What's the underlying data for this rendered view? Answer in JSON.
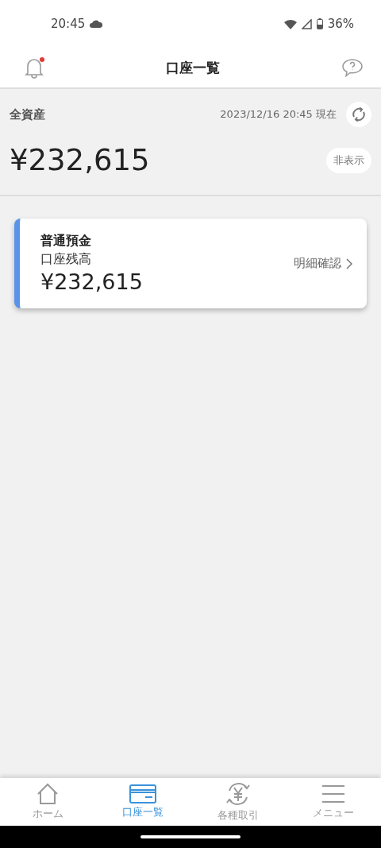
{
  "status_bar": {
    "time": "20:45",
    "battery": "36%"
  },
  "header": {
    "title": "口座一覧",
    "notification_unread": true
  },
  "total": {
    "label": "全資産",
    "timestamp": "2023/12/16 20:45 現在",
    "amount": "¥232,615",
    "hide_button": "非表示"
  },
  "accounts": [
    {
      "type": "普通預金",
      "label": "口座残高",
      "amount": "¥232,615",
      "link": "明細確認",
      "color": "#5b93ea"
    }
  ],
  "tabs": [
    {
      "label": "ホーム",
      "kind": "home",
      "selected": false
    },
    {
      "label": "口座一覧",
      "kind": "card",
      "selected": true
    },
    {
      "label": "各種取引",
      "kind": "exchange",
      "selected": false
    },
    {
      "label": "メニュー",
      "kind": "menu",
      "selected": false
    }
  ]
}
